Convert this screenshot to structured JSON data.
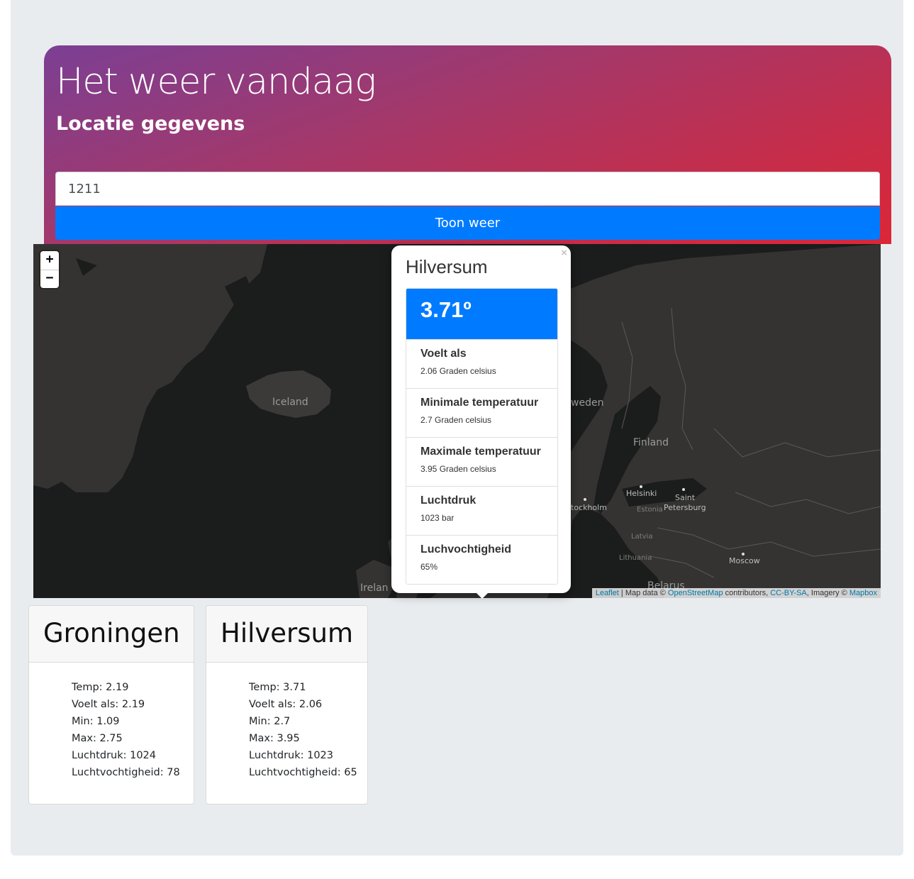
{
  "header": {
    "title": "Het weer vandaag",
    "subtitle": "Locatie gegevens"
  },
  "search": {
    "value": "1211",
    "button_label": "Toon weer"
  },
  "map": {
    "zoom_in_label": "+",
    "zoom_out_label": "−",
    "labels": {
      "iceland": "Iceland",
      "sweden": "weden",
      "finland": "Finland",
      "helsinki": "Helsinki",
      "saint": "Saint",
      "petersburg": "Petersburg",
      "stockholm": "tockholm",
      "estonia": "Estonia",
      "latvia": "Latvia",
      "lithuania": "Lithuania",
      "moscow": "Moscow",
      "ireland": "Irelan",
      "belarus": "Belarus"
    },
    "attribution": {
      "leaflet": "Leaflet",
      "map_data": " | Map data © ",
      "osm": "OpenStreetMap",
      "contributors": " contributors, ",
      "license": "CC-BY-SA",
      "imagery": ", Imagery © ",
      "mapbox": "Mapbox"
    }
  },
  "popup": {
    "close_label": "×",
    "city": "Hilversum",
    "temperature": "3.71º",
    "items": [
      {
        "label": "Voelt als",
        "value": "2.06 Graden celsius"
      },
      {
        "label": "Minimale temperatuur",
        "value": "2.7 Graden celsius"
      },
      {
        "label": "Maximale temperatuur",
        "value": "3.95 Graden celsius"
      },
      {
        "label": "Luchtdruk",
        "value": "1023 bar"
      },
      {
        "label": "Luchvochtigheid",
        "value": "65%"
      }
    ]
  },
  "cards": [
    {
      "city": "Groningen",
      "lines": [
        "Temp: 2.19",
        "Voelt als: 2.19",
        "Min: 1.09",
        "Max: 2.75",
        "Luchtdruk: 1024",
        "Luchtvochtigheid: 78"
      ]
    },
    {
      "city": "Hilversum",
      "lines": [
        "Temp: 3.71",
        "Voelt als: 2.06",
        "Min: 2.7",
        "Max: 3.95",
        "Luchtdruk: 1023",
        "Luchtvochtigheid: 65"
      ]
    }
  ],
  "colors": {
    "primary": "#007bff",
    "header_gradient_start": "#7b3f94",
    "header_gradient_end": "#dc2637",
    "page_background": "#e9ecef",
    "map_water": "#1b1c1c",
    "map_land": "#343332"
  }
}
